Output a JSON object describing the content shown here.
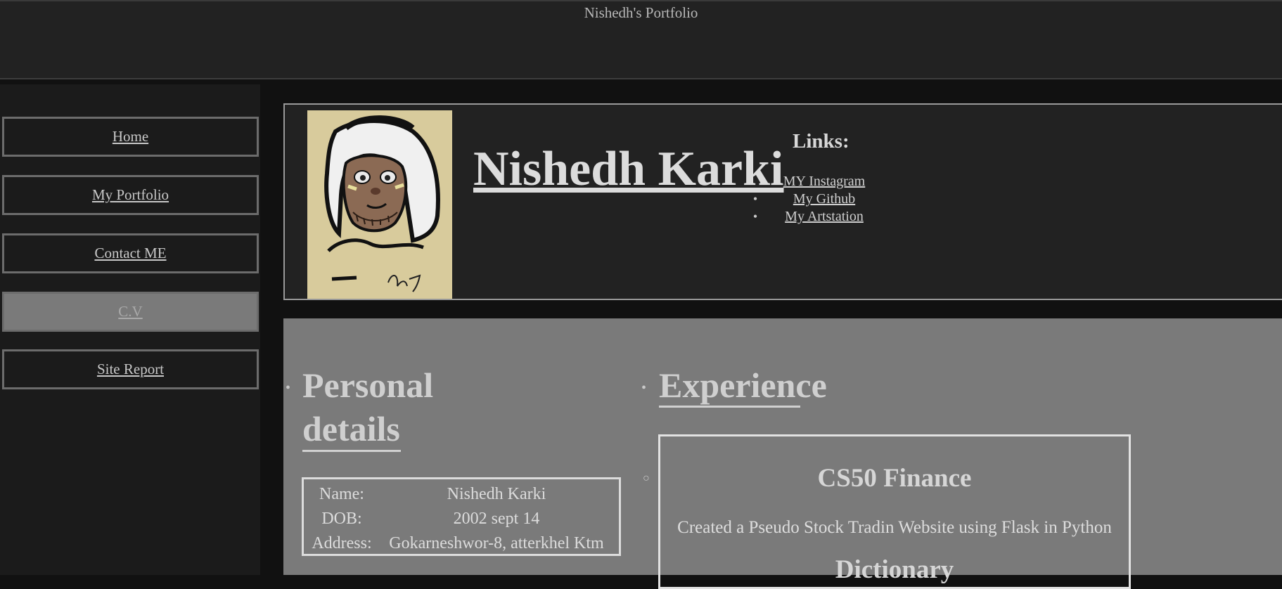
{
  "app": {
    "title": "Nishedh's Portfolio"
  },
  "sidebar": {
    "items": [
      {
        "label": "Home",
        "active": false
      },
      {
        "label": "My Portfolio",
        "active": false
      },
      {
        "label": "Contact ME",
        "active": false
      },
      {
        "label": "C.V",
        "active": true
      },
      {
        "label": "Site Report",
        "active": false
      }
    ]
  },
  "profile": {
    "name": "Nishedh Karki",
    "avatar_icon": "portrait-sketch",
    "links_title": "Links:",
    "links": [
      {
        "label": "MY Instagram",
        "bullet": ""
      },
      {
        "label": "My Github",
        "bullet": "•"
      },
      {
        "label": "My Artstation",
        "bullet": "•"
      }
    ]
  },
  "personal": {
    "heading_line1": "Personal",
    "heading_line2": "details",
    "bullet": "•",
    "rows": [
      {
        "key": "Name:",
        "value": "Nishedh Karki"
      },
      {
        "key": "DOB:",
        "value": "2002 sept 14"
      },
      {
        "key": "Address:",
        "value": "Gokarneshwor-8, atterkhel Ktm"
      }
    ]
  },
  "experience": {
    "heading": "Experience",
    "bullet": "•",
    "item_bullet": "○",
    "items": [
      {
        "title": "CS50 Finance",
        "description": "Created a Pseudo Stock Tradin Website using Flask in Python"
      },
      {
        "title": "Dictionary",
        "description": ""
      }
    ]
  },
  "colors": {
    "page_bg": "#111111",
    "header_bg": "#222222",
    "sidebar_bg": "#1b1b1b",
    "content_bg": "#7a7a7a",
    "active_nav_bg": "#7a7a7a",
    "avatar_bg": "#d8cb9c"
  }
}
